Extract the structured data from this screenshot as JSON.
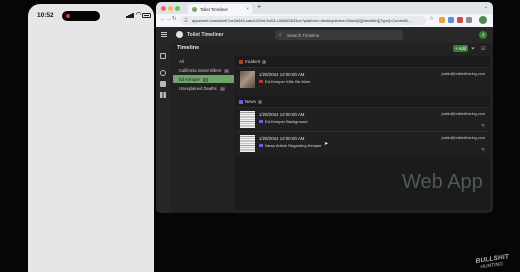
{
  "phone": {
    "time": "10:52",
    "icons": [
      "record-dot-icon",
      "signal-icon",
      "wifi-icon",
      "battery-icon"
    ]
  },
  "browser": {
    "tab_title": "Toilet Timeliner",
    "tab_close": "×",
    "new_tab": "+",
    "url": "appsheet.com/start/?ce2a349-caed-42bd-9a03-c3600f3b33ce?platform=desktop#view=Black[0][Identifier][Type]=ControlB...",
    "icons": [
      "back-arrow-icon",
      "forward-arrow-icon",
      "reload-icon",
      "site-info-icon",
      "bookmark-star-icon",
      "extensions-icon",
      "profile-icon",
      "tab-menu-icon"
    ]
  },
  "app": {
    "title": "Toilet Timeliner",
    "search_placeholder": "Search Timeline",
    "avatar_initial": "J",
    "view_title": "Timeline",
    "add_label": "+ Add",
    "categories": [
      {
        "label": "All",
        "count": ""
      },
      {
        "label": "California Serial Killers",
        "count": "1"
      },
      {
        "label": "Ed Kemper",
        "count": "3",
        "selected": true
      },
      {
        "label": "Unexplained Deaths",
        "count": "1"
      }
    ],
    "groups": [
      {
        "name": "Incident",
        "count": "1",
        "color": "#c0392b",
        "items": [
          {
            "date": "1/28/2024 12:00:00 AM",
            "title": "Ed Kemper Kills His Mom",
            "tag_color": "#c0392b",
            "email": "justin@bullshitharing.com",
            "thumb": "photo"
          }
        ]
      },
      {
        "name": "News",
        "count": "2",
        "color": "#6c5ce7",
        "items": [
          {
            "date": "1/28/2024 12:00:00 AM",
            "title": "Ed Kemper Background",
            "tag_color": "#6c5ce7",
            "email": "justin@bullshitharing.com",
            "thumb": "doc"
          },
          {
            "date": "1/28/2024 12:00:00 AM",
            "title": "News Article Regarding Kemper",
            "tag_color": "#6c5ce7",
            "email": "justin@bullshitharing.com",
            "thumb": "doc"
          }
        ]
      }
    ]
  },
  "overlay": {
    "watermark": "Web App"
  },
  "logo": {
    "line1": "BULLSHIT",
    "line2": "HUNTING"
  },
  "colors": {
    "accent_green": "#6fa46a",
    "incident_red": "#c0392b",
    "news_purple": "#6c5ce7"
  }
}
